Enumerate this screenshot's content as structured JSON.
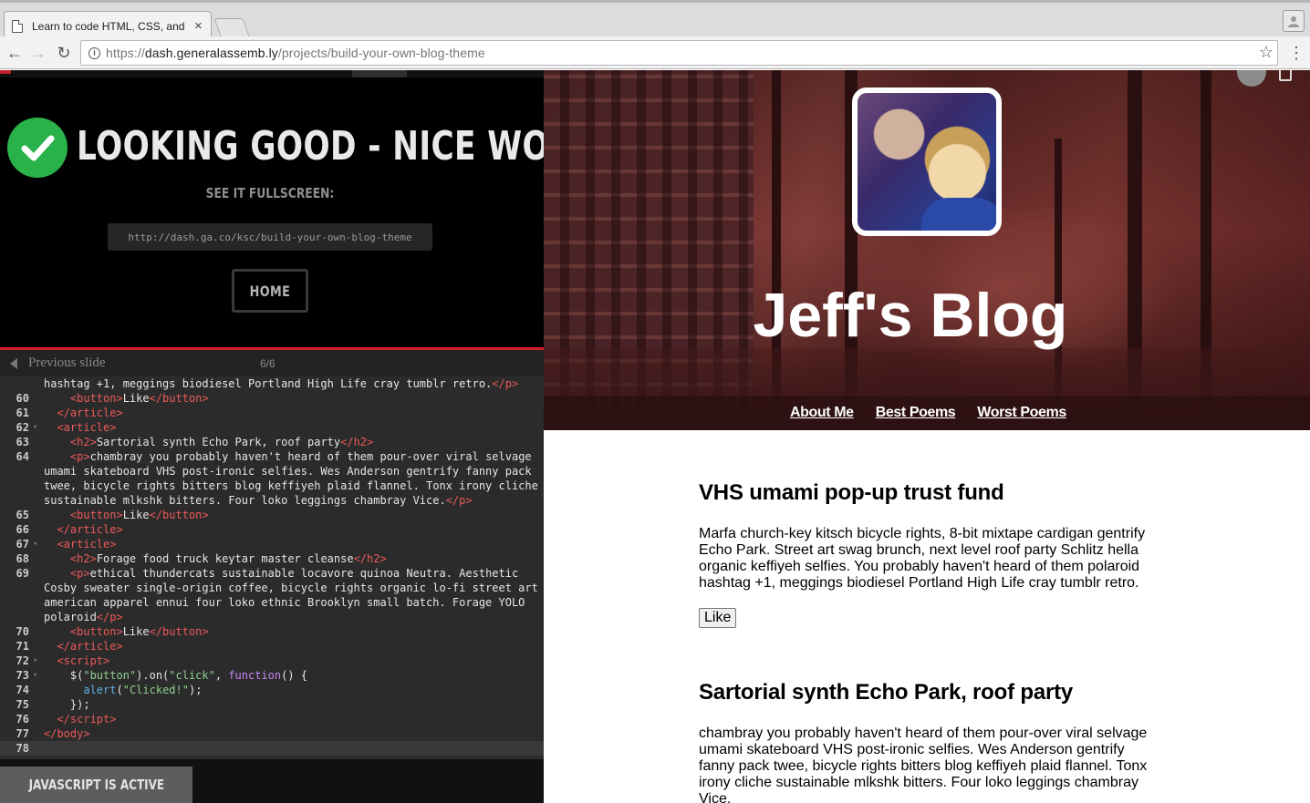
{
  "browser": {
    "tab_title": "Learn to code HTML, CSS, and",
    "tab_close": "×",
    "url_scheme": "https://",
    "url_host": "dash.generalassemb.ly",
    "url_path": "/projects/build-your-own-blog-theme",
    "icons": {
      "back": "←",
      "forward": "→",
      "reload": "↻",
      "star": "☆",
      "menu": "⋮",
      "info": "i",
      "profile": "👤"
    }
  },
  "left_panel": {
    "heading": "LOOKING GOOD - NICE WORK!",
    "see_fullscreen": "SEE IT FULLSCREEN:",
    "fullscreen_url": "http://dash.ga.co/ksc/build-your-own-blog-theme",
    "home_button": "HOME",
    "previous_slide": "Previous slide",
    "slide_counter": "6/6",
    "partial_line": "hashtag +1, meggings biodiesel Portland High Life cray tumblr retro.",
    "partial_line_tag": "</p>",
    "code_lines": [
      {
        "n": "60",
        "fold": "",
        "html": "    <span class=\"tag\">&lt;button&gt;</span>Like<span class=\"tag\">&lt;/button&gt;</span>"
      },
      {
        "n": "61",
        "fold": "",
        "html": "  <span class=\"tag\">&lt;/article&gt;</span>"
      },
      {
        "n": "62",
        "fold": "▾",
        "html": "  <span class=\"tag\">&lt;article&gt;</span>"
      },
      {
        "n": "63",
        "fold": "",
        "html": "    <span class=\"tag\">&lt;h2&gt;</span>Sartorial synth Echo Park, roof party<span class=\"tag\">&lt;/h2&gt;</span>"
      },
      {
        "n": "64",
        "fold": "",
        "html": "    <span class=\"tag\">&lt;p&gt;</span>chambray you probably haven't heard of them pour-over viral selvage umami skateboard VHS post-ironic selfies. Wes Anderson gentrify fanny pack twee, bicycle rights bitters blog keffiyeh plaid flannel. Tonx irony cliche sustainable mlkshk bitters. Four loko leggings chambray Vice.<span class=\"tag\">&lt;/p&gt;</span>"
      },
      {
        "n": "65",
        "fold": "",
        "html": "    <span class=\"tag\">&lt;button&gt;</span>Like<span class=\"tag\">&lt;/button&gt;</span>"
      },
      {
        "n": "66",
        "fold": "",
        "html": "  <span class=\"tag\">&lt;/article&gt;</span>"
      },
      {
        "n": "67",
        "fold": "▾",
        "html": "  <span class=\"tag\">&lt;article&gt;</span>"
      },
      {
        "n": "68",
        "fold": "",
        "html": "    <span class=\"tag\">&lt;h2&gt;</span>Forage food truck keytar master cleanse<span class=\"tag\">&lt;/h2&gt;</span>"
      },
      {
        "n": "69",
        "fold": "",
        "html": "    <span class=\"tag\">&lt;p&gt;</span>ethical thundercats sustainable locavore quinoa Neutra. Aesthetic Cosby sweater single-origin coffee, bicycle rights organic lo-fi street art american apparel ennui four loko ethnic Brooklyn small batch. Forage YOLO polaroid<span class=\"tag\">&lt;/p&gt;</span>"
      },
      {
        "n": "70",
        "fold": "",
        "html": "    <span class=\"tag\">&lt;button&gt;</span>Like<span class=\"tag\">&lt;/button&gt;</span>"
      },
      {
        "n": "71",
        "fold": "",
        "html": "  <span class=\"tag\">&lt;/article&gt;</span>"
      },
      {
        "n": "72",
        "fold": "▾",
        "html": "  <span class=\"tag\">&lt;script&gt;</span>"
      },
      {
        "n": "73",
        "fold": "▾",
        "html": "    $(<span class=\"str\">\"button\"</span>).on(<span class=\"str\">\"click\"</span>, <span class=\"kw\">function</span>() {"
      },
      {
        "n": "74",
        "fold": "",
        "html": "      <span class=\"fn\">alert</span>(<span class=\"str\">\"Clicked!\"</span>);"
      },
      {
        "n": "75",
        "fold": "",
        "html": "    });"
      },
      {
        "n": "76",
        "fold": "",
        "html": "  <span class=\"tag\">&lt;/script&gt;</span>"
      },
      {
        "n": "77",
        "fold": "",
        "html": "<span class=\"tag\">&lt;/body&gt;</span>"
      },
      {
        "n": "78",
        "fold": "",
        "html": "",
        "current": true
      }
    ],
    "js_status": "JAVASCRIPT IS ACTIVE"
  },
  "preview": {
    "blog_title": "Jeff's Blog",
    "nav": [
      "About Me",
      "Best Poems",
      "Worst Poems"
    ],
    "posts": [
      {
        "title": "VHS umami pop-up trust fund",
        "body": "Marfa church-key kitsch bicycle rights, 8-bit mixtape cardigan gentrify Echo Park. Street art swag brunch, next level roof party Schlitz hella organic keffiyeh selfies. You probably haven't heard of them polaroid hashtag +1, meggings biodiesel Portland High Life cray tumblr retro.",
        "button": "Like"
      },
      {
        "title": "Sartorial synth Echo Park, roof party",
        "body": "chambray you probably haven't heard of them pour-over viral selvage umami skateboard VHS post-ironic selfies. Wes Anderson gentrify fanny pack twee, bicycle rights bitters blog keffiyeh plaid flannel. Tonx irony cliche sustainable mlkshk bitters. Four loko leggings chambray Vice."
      }
    ]
  },
  "colors": {
    "success_green": "#2ab24a",
    "accent_red": "#d4202b",
    "code_tag": "#ec5a59",
    "code_string": "#8fd08f",
    "code_keyword": "#c785f5"
  }
}
